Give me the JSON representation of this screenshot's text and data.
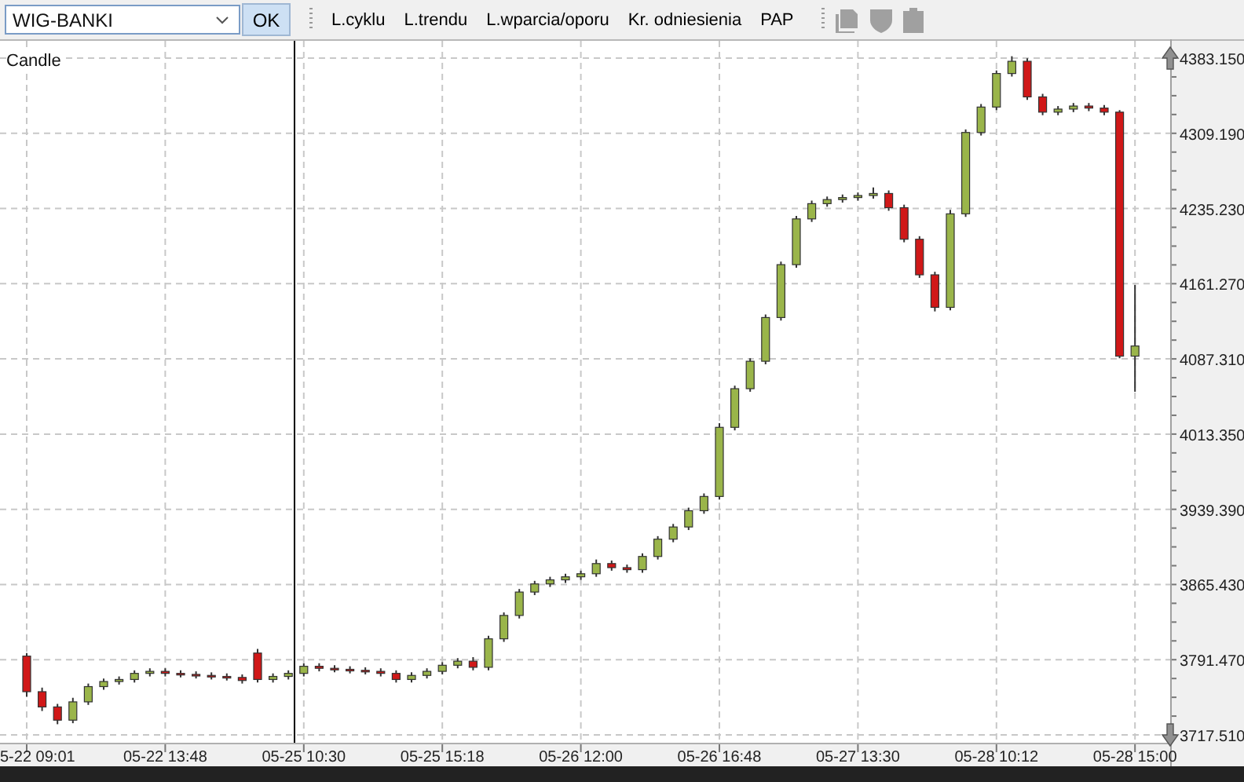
{
  "instrument_select": {
    "value": "WIG-BANKI"
  },
  "ok_button": "OK",
  "toolbar_links": [
    "L.cyklu",
    "L.trendu",
    "L.wparcia/oporu",
    "Kr. odniesienia",
    "PAP"
  ],
  "chart": {
    "type_label": "Candle",
    "time_labels": [
      "5-22 09:01",
      "05-22 13:48",
      "05-25 10:30",
      "05-25 15:18",
      "05-26 12:00",
      "05-26 16:48",
      "05-27 13:30",
      "05-28 10:12",
      "05-28 15:00"
    ],
    "chart_data": {
      "type": "candlestick",
      "grid": true,
      "ylim": [
        3717.51,
        4383.15
      ],
      "ohlc": [
        [
          3795,
          3798,
          3755,
          3760
        ],
        [
          3760,
          3764,
          3741,
          3745
        ],
        [
          3745,
          3748,
          3728,
          3732
        ],
        [
          3732,
          3754,
          3729,
          3750
        ],
        [
          3750,
          3768,
          3747,
          3765
        ],
        [
          3765,
          3773,
          3762,
          3770
        ],
        [
          3770,
          3775,
          3767,
          3772
        ],
        [
          3772,
          3781,
          3769,
          3778
        ],
        [
          3778,
          3783,
          3775,
          3780
        ],
        [
          3780,
          3783,
          3775,
          3778
        ],
        [
          3778,
          3781,
          3774,
          3777
        ],
        [
          3777,
          3780,
          3773,
          3776
        ],
        [
          3776,
          3779,
          3772,
          3775
        ],
        [
          3775,
          3778,
          3771,
          3774
        ],
        [
          3774,
          3777,
          3768,
          3771
        ],
        [
          3798,
          3802,
          3769,
          3772
        ],
        [
          3772,
          3778,
          3769,
          3775
        ],
        [
          3775,
          3781,
          3772,
          3778
        ],
        [
          3778,
          3788,
          3775,
          3785
        ],
        [
          3785,
          3788,
          3780,
          3783
        ],
        [
          3783,
          3786,
          3779,
          3782
        ],
        [
          3782,
          3785,
          3778,
          3781
        ],
        [
          3781,
          3784,
          3777,
          3780
        ],
        [
          3780,
          3783,
          3775,
          3778
        ],
        [
          3778,
          3781,
          3769,
          3772
        ],
        [
          3772,
          3779,
          3769,
          3776
        ],
        [
          3776,
          3783,
          3773,
          3780
        ],
        [
          3780,
          3789,
          3777,
          3786
        ],
        [
          3786,
          3793,
          3783,
          3790
        ],
        [
          3790,
          3794,
          3781,
          3784
        ],
        [
          3784,
          3815,
          3781,
          3812
        ],
        [
          3812,
          3838,
          3809,
          3835
        ],
        [
          3835,
          3861,
          3832,
          3858
        ],
        [
          3858,
          3869,
          3855,
          3866
        ],
        [
          3866,
          3873,
          3863,
          3870
        ],
        [
          3870,
          3876,
          3867,
          3873
        ],
        [
          3873,
          3879,
          3870,
          3876
        ],
        [
          3876,
          3890,
          3873,
          3886
        ],
        [
          3886,
          3889,
          3879,
          3882
        ],
        [
          3882,
          3885,
          3877,
          3880
        ],
        [
          3880,
          3896,
          3877,
          3893
        ],
        [
          3893,
          3913,
          3890,
          3910
        ],
        [
          3910,
          3925,
          3907,
          3922
        ],
        [
          3922,
          3941,
          3919,
          3938
        ],
        [
          3938,
          3955,
          3935,
          3952
        ],
        [
          3952,
          4024,
          3949,
          4020
        ],
        [
          4020,
          4061,
          4017,
          4058
        ],
        [
          4058,
          4088,
          4055,
          4085
        ],
        [
          4085,
          4131,
          4082,
          4128
        ],
        [
          4128,
          4183,
          4125,
          4180
        ],
        [
          4180,
          4228,
          4177,
          4225
        ],
        [
          4225,
          4243,
          4222,
          4240
        ],
        [
          4240,
          4247,
          4237,
          4244
        ],
        [
          4244,
          4249,
          4241,
          4246
        ],
        [
          4246,
          4251,
          4243,
          4248
        ],
        [
          4248,
          4256,
          4245,
          4250
        ],
        [
          4250,
          4253,
          4233,
          4236
        ],
        [
          4236,
          4239,
          4202,
          4205
        ],
        [
          4205,
          4208,
          4167,
          4170
        ],
        [
          4170,
          4173,
          4134,
          4138
        ],
        [
          4138,
          4234,
          4135,
          4230
        ],
        [
          4230,
          4313,
          4227,
          4310
        ],
        [
          4310,
          4338,
          4307,
          4335
        ],
        [
          4335,
          4371,
          4332,
          4368
        ],
        [
          4368,
          4385,
          4365,
          4380
        ],
        [
          4380,
          4383,
          4342,
          4345
        ],
        [
          4345,
          4348,
          4327,
          4330
        ],
        [
          4330,
          4336,
          4327,
          4333
        ],
        [
          4333,
          4339,
          4330,
          4336
        ],
        [
          4336,
          4339,
          4331,
          4334
        ],
        [
          4334,
          4337,
          4327,
          4330
        ],
        [
          4330,
          4332,
          4088,
          4090
        ],
        [
          4090,
          4160,
          4055,
          4100
        ]
      ],
      "yticks": [
        {
          "value": 4383.15,
          "label": "4383.150"
        },
        {
          "value": 4309.19,
          "label": "4309.190"
        },
        {
          "value": 4235.23,
          "label": "4235.230"
        },
        {
          "value": 4161.27,
          "label": "4161.270"
        },
        {
          "value": 4087.31,
          "label": "4087.310"
        },
        {
          "value": 4013.35,
          "label": "4013.350"
        },
        {
          "value": 3939.39,
          "label": "3939.390"
        },
        {
          "value": 3865.43,
          "label": "3865.430"
        },
        {
          "value": 3791.47,
          "label": "3791.470"
        },
        {
          "value": 3717.51,
          "label": "3717.510"
        }
      ]
    }
  }
}
